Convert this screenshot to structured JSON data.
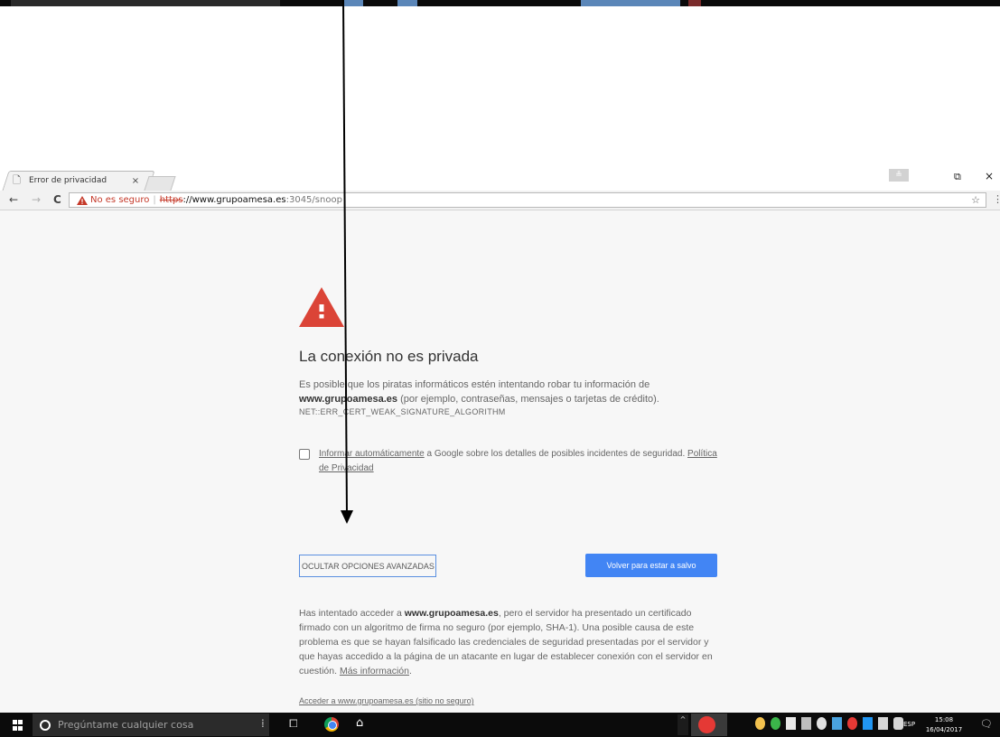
{
  "browser": {
    "tab": {
      "title": "Error de privacidad",
      "close": "×"
    },
    "window": {
      "profile_glyph": "≗",
      "restore_glyph": "⧉",
      "close_glyph": "×"
    },
    "toolbar": {
      "back": "←",
      "forward": "→",
      "reload": "C",
      "security_label": "No es seguro",
      "separator": "|",
      "url_scheme": "https",
      "url_host": "://www.grupoamesa.es",
      "url_path": ":3045/snoop",
      "star": "☆",
      "menu": "⋮"
    }
  },
  "interstitial": {
    "heading": "La conexión no es privada",
    "explain_pre": "Es posible que los piratas informáticos estén intentando robar tu información de",
    "explain_host": "www.grupoamesa.es",
    "explain_post": "(por ejemplo, contraseñas, mensajes o tarjetas de crédito).",
    "error_code": "NET::ERR_CERT_WEAK_SIGNATURE_ALGORITHM",
    "report_link": "Informar automáticamente",
    "report_text": "a Google sobre los detalles de posibles incidentes de seguridad.",
    "privacy_link": "Política de Privacidad",
    "advanced_button": "OCULTAR OPCIONES AVANZADAS",
    "safe_button": "Volver para estar a salvo",
    "details_pre": "Has intentado acceder a",
    "details_host": "www.grupoamesa.es",
    "details_post": ", pero el servidor ha presentado un certificado firmado con un algoritmo de firma no seguro (por ejemplo, SHA-1). Una posible causa de este problema es que se hayan falsificado las credenciales de seguridad presentadas por el servidor y que hayas accedido a la página de un atacante en lugar de establecer conexión con el servidor en cuestión.",
    "more_info_link": "Más información",
    "details_end": ".",
    "proceed_link": "Acceder a www.grupoamesa.es (sitio no seguro)"
  },
  "taskbar": {
    "search_placeholder": "Pregúntame cualquier cosa",
    "language": "ESP",
    "time": "15:08",
    "date": "16/04/2017",
    "tray_up": "^"
  },
  "colors": {
    "danger": "#db4437",
    "primary_button": "#4285f4",
    "insecure_text": "#c53929"
  }
}
